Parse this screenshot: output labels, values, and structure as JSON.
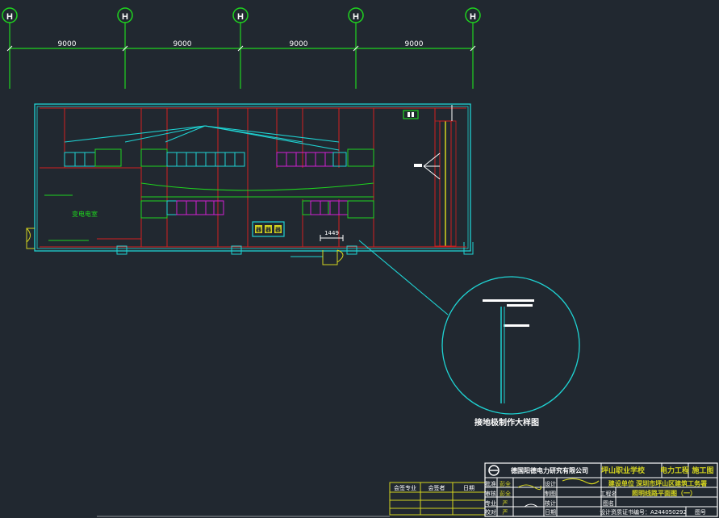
{
  "axes": [
    {
      "label": "H"
    },
    {
      "label": "H"
    },
    {
      "label": "H"
    },
    {
      "label": "H"
    },
    {
      "label": "H"
    }
  ],
  "dimensions": [
    "9000",
    "9000",
    "9000",
    "9000"
  ],
  "room_label": "变电电室",
  "cabinet_labels": [
    "器",
    "器",
    "器"
  ],
  "inner_dim": "1449",
  "detail_caption": "接地极制作大样图",
  "approval_table": {
    "headers": [
      "会签专业",
      "会签者",
      "日期"
    ]
  },
  "title_block": {
    "company": "德国阳德电力研究有限公司",
    "school": "坪山职业学校",
    "discipline": "电力工程",
    "stage": "施工图",
    "roles": [
      "批准",
      "审核",
      "专业",
      "校对"
    ],
    "names": [
      "彭全",
      "彭全",
      "严",
      "严"
    ],
    "design_roles": [
      "设计",
      "制图",
      "核计",
      "日期"
    ],
    "project_name": "建设单位 深圳市坪山区建筑工务署",
    "drawing_name": "照明线路平面图（一）",
    "project_label": "工程名",
    "figure_label": "图名",
    "cert": "设计资质证书编号：A244050292",
    "figure_no": "图号"
  },
  "colors": {
    "background": "#212830",
    "axis": "#1fd41f",
    "wall": "#1fd3d3",
    "wiring": "#d41f1f",
    "panel_cyan": "#1fd3d3",
    "panel_magenta": "#d41fd4",
    "text_white": "#ffffff",
    "title_yellow": "#d4d41f"
  }
}
